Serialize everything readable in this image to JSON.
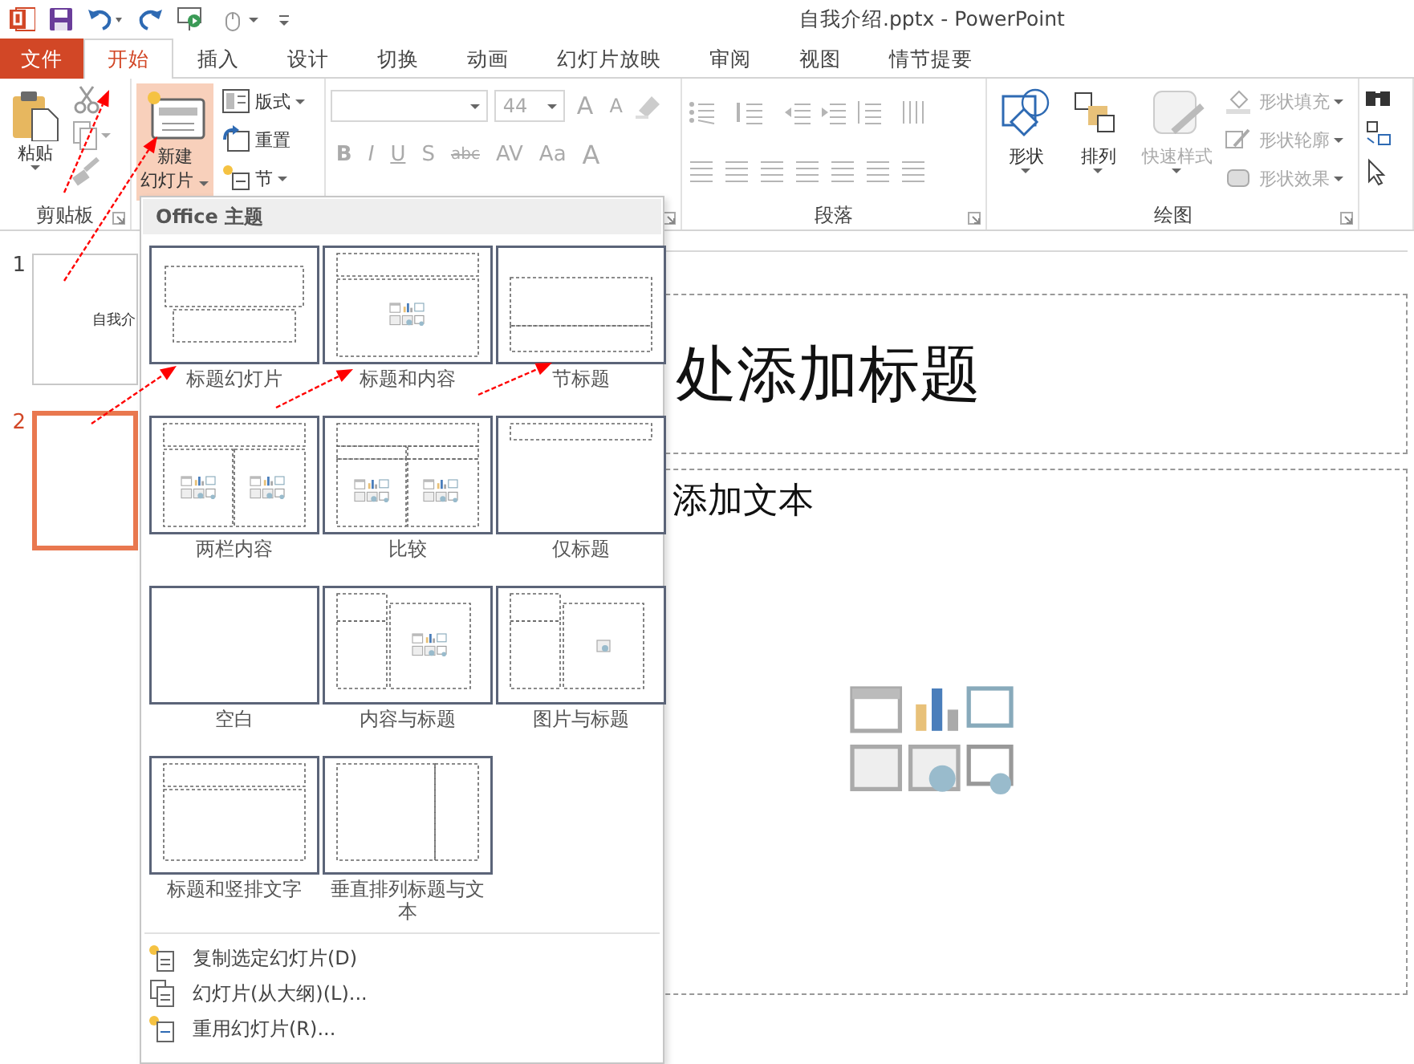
{
  "window": {
    "title": "自我介绍.pptx - PowerPoint"
  },
  "tabs": [
    {
      "label": "文件",
      "kind": "file",
      "selected": false
    },
    {
      "label": "开始",
      "kind": "tab",
      "selected": true
    },
    {
      "label": "插入",
      "kind": "tab",
      "selected": false
    },
    {
      "label": "设计",
      "kind": "tab",
      "selected": false
    },
    {
      "label": "切换",
      "kind": "tab",
      "selected": false
    },
    {
      "label": "动画",
      "kind": "tab",
      "selected": false
    },
    {
      "label": "幻灯片放映",
      "kind": "tab",
      "selected": false
    },
    {
      "label": "审阅",
      "kind": "tab",
      "selected": false
    },
    {
      "label": "视图",
      "kind": "tab",
      "selected": false
    },
    {
      "label": "情节提要",
      "kind": "tab",
      "selected": false
    }
  ],
  "clipboard": {
    "label": "剪贴板",
    "paste": "粘贴"
  },
  "slides_group": {
    "new_slide": [
      "新建",
      "幻灯片"
    ],
    "pressed": true,
    "items": [
      {
        "label": "版式",
        "caret": true
      },
      {
        "label": "重置",
        "caret": false
      },
      {
        "label": "节",
        "caret": true
      }
    ]
  },
  "font": {
    "disabled": true,
    "size": "44",
    "grow": [
      "A",
      "A"
    ],
    "buttons": [
      "B",
      "I",
      "U",
      "S",
      "abc",
      "AV",
      "Aa",
      "A"
    ]
  },
  "paragraph": {
    "label": "段落",
    "disabled": true
  },
  "drawing": {
    "label": "绘图",
    "buttons": [
      {
        "label": "形状",
        "disabled": false
      },
      {
        "label": "排列",
        "disabled": false
      },
      {
        "label": "快速样式",
        "disabled": true
      }
    ],
    "format": [
      {
        "label": "形状填充",
        "disabled": true
      },
      {
        "label": "形状轮廓",
        "disabled": true
      },
      {
        "label": "形状效果",
        "disabled": true
      }
    ]
  },
  "thumbnails": [
    {
      "number": "1",
      "text": "自我介",
      "selected": false
    },
    {
      "number": "2",
      "selected": true
    }
  ],
  "slide": {
    "title": "处添加标题",
    "body": "添加文本"
  },
  "layout_menu": {
    "header": "Office 主题",
    "layouts": [
      {
        "name": "标题幻灯片",
        "kind": "title"
      },
      {
        "name": "标题和内容",
        "kind": "title_content"
      },
      {
        "name": "节标题",
        "kind": "section"
      },
      {
        "name": "两栏内容",
        "kind": "two_content"
      },
      {
        "name": "比较",
        "kind": "comparison"
      },
      {
        "name": "仅标题",
        "kind": "title_only"
      },
      {
        "name": "空白",
        "kind": "blank"
      },
      {
        "name": "内容与标题",
        "kind": "content_caption"
      },
      {
        "name": "图片与标题",
        "kind": "picture_caption"
      },
      {
        "name": "标题和竖排文字",
        "kind": "vertical_text"
      },
      {
        "name": "垂直排列标题与文本",
        "kind": "vertical_title"
      }
    ],
    "commands": [
      "复制选定幻灯片(D)",
      "幻灯片(从大纲)(L)...",
      "重用幻灯片(R)..."
    ]
  },
  "annotations": {
    "arrows": true
  }
}
